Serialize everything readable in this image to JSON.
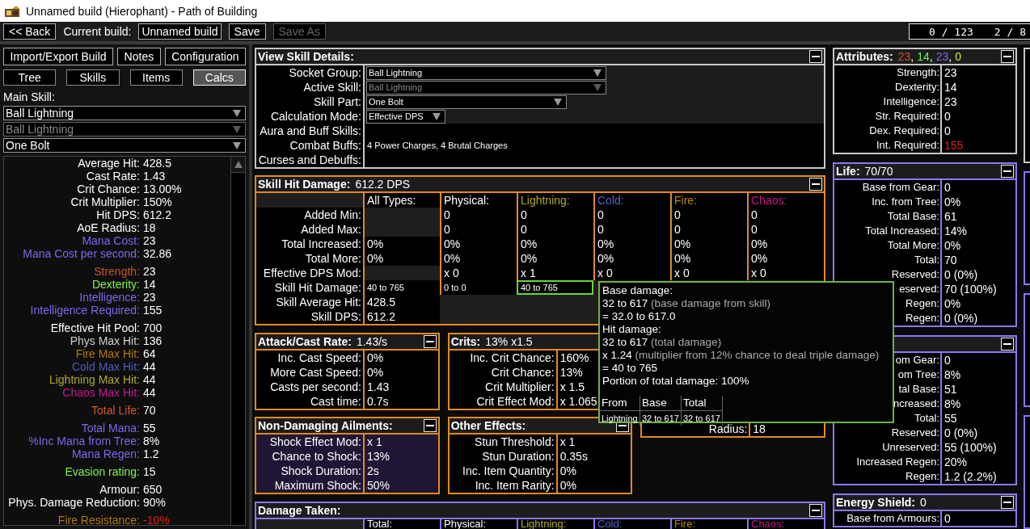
{
  "window": {
    "title": "Unnamed build (Hierophant) - Path of Building"
  },
  "toolbar": {
    "back": "<< Back",
    "current_build_label": "Current build:",
    "build_name": "Unnamed build",
    "buttons": [
      {
        "label": "Save",
        "disabled": false
      },
      {
        "label": "Save As",
        "disabled": true
      }
    ],
    "points": [
      "0 / 123",
      "2 / 8"
    ]
  },
  "left": {
    "buttons": [
      "Import/Export Build",
      "Notes",
      "Configuration"
    ],
    "tabs": [
      {
        "label": "Tree",
        "selected": false
      },
      {
        "label": "Skills",
        "selected": false
      },
      {
        "label": "Items",
        "selected": false
      },
      {
        "label": "Calcs",
        "selected": true
      }
    ],
    "main_skill_label": "Main Skill:",
    "dropdowns": [
      {
        "value": "Ball Lightning",
        "disabled": false
      },
      {
        "value": "Ball Lightning",
        "disabled": true
      },
      {
        "value": "One Bolt",
        "disabled": false
      }
    ],
    "stats": [
      [
        {
          "label": "Average Hit:",
          "value": "428.5",
          "color": "#ffffff"
        },
        {
          "label": "Cast Rate:",
          "value": "1.43",
          "color": "#ffffff"
        },
        {
          "label": "Crit Chance:",
          "value": "13.00%",
          "color": "#ffffff"
        },
        {
          "label": "Crit Multiplier:",
          "value": "150%",
          "color": "#ffffff"
        },
        {
          "label": "Hit DPS:",
          "value": "612.2",
          "color": "#ffffff"
        },
        {
          "label": "AoE Radius:",
          "value": "18",
          "color": "#ffffff"
        },
        {
          "label": "Mana Cost:",
          "value": "23",
          "color": "#7b68ee"
        },
        {
          "label": "Mana Cost per second:",
          "value": "32.86",
          "color": "#7b68ee"
        }
      ],
      [
        {
          "label": "Strength:",
          "value": "23",
          "color": "#c8552d"
        },
        {
          "label": "Dexterity:",
          "value": "14",
          "color": "#7cf34a"
        },
        {
          "label": "Intelligence:",
          "value": "23",
          "color": "#7b68ee"
        },
        {
          "label": "Intelligence Required:",
          "value": "155",
          "color": "#7b68ee"
        }
      ],
      [
        {
          "label": "Effective Hit Pool:",
          "value": "700",
          "color": "#ffffff"
        },
        {
          "label": "Phys Max Hit:",
          "value": "136",
          "color": "#d0d0d0"
        },
        {
          "label": "Fire Max Hit:",
          "value": "64",
          "color": "#b07a10"
        },
        {
          "label": "Cold Max Hit:",
          "value": "44",
          "color": "#4a5bbd"
        },
        {
          "label": "Lightning Max Hit:",
          "value": "44",
          "color": "#adaa2a"
        },
        {
          "label": "Chaos Max Hit:",
          "value": "44",
          "color": "#c41a8c"
        }
      ],
      [
        {
          "label": "Total Life:",
          "value": "70",
          "color": "#d0582e"
        }
      ],
      [
        {
          "label": "Total Mana:",
          "value": "55",
          "color": "#7b68ee"
        },
        {
          "label": "%Inc Mana from Tree:",
          "value": "8%",
          "color": "#7b68ee"
        },
        {
          "label": "Mana Regen:",
          "value": "1.2",
          "color": "#7b68ee"
        }
      ],
      [
        {
          "label": "Evasion rating:",
          "value": "15",
          "color": "#7cf34a"
        }
      ],
      [
        {
          "label": "Armour:",
          "value": "650",
          "color": "#ffffff"
        },
        {
          "label": "Phys. Damage Reduction:",
          "value": "90%",
          "color": "#ffffff"
        }
      ],
      [
        {
          "label": "Fire Resistance:",
          "value": {
            "text": "-10%",
            "color": "#e02020"
          },
          "color": "#b07a10"
        }
      ]
    ]
  },
  "skill_details": {
    "title": "View Skill Details:",
    "color": "#c8c8c8",
    "rows": [
      {
        "label": "Socket Group:",
        "kind": "dropdown",
        "value": "Ball Lightning",
        "disabled": false
      },
      {
        "label": "Active Skill:",
        "kind": "dropdown",
        "value": "Ball Lightning",
        "disabled": true
      },
      {
        "label": "Skill Part:",
        "kind": "dropdown",
        "value": "One Bolt",
        "disabled": false
      },
      {
        "label": "Calculation Mode:",
        "kind": "dropdown",
        "value": "Effective DPS",
        "disabled": false
      },
      {
        "label": "Aura and Buff Skills:",
        "kind": "text"
      },
      {
        "label": "Combat Buffs:",
        "kind": "text",
        "value": "4 Power Charges, 4 Brutal Charges"
      },
      {
        "label": "Curses and Debuffs:",
        "kind": "text"
      }
    ]
  },
  "hit_damage": {
    "title": "Skill Hit Damage:",
    "summary": "612.2 DPS",
    "color": "#e08a1e",
    "columns": [
      {
        "label": "All Types:"
      },
      {
        "label": "Physical:"
      },
      {
        "label": "Lightning:",
        "color": "#adaa2a"
      },
      {
        "label": "Cold:",
        "color": "#5a64c8"
      },
      {
        "label": "Fire:",
        "color": "#b8860b"
      },
      {
        "label": "Chaos:",
        "color": "#c41a8c"
      }
    ],
    "rows": [
      {
        "label": "Added Min:",
        "cells": [
          null,
          "0",
          "0",
          "0",
          "0",
          "0"
        ]
      },
      {
        "label": "Added Max:",
        "cells": [
          null,
          "0",
          "0",
          "0",
          "0",
          "0"
        ]
      },
      {
        "label": "Total Increased:",
        "cells": [
          "0%",
          "0%",
          "0%",
          "0%",
          "0%",
          "0%"
        ]
      },
      {
        "label": "Total More:",
        "cells": [
          "0%",
          "0%",
          "0%",
          "0%",
          "0%",
          "0%"
        ]
      },
      {
        "label": "Effective DPS Mod:",
        "cells": [
          null,
          "x 0",
          "x 1",
          "x 0",
          "x 0",
          "x 0"
        ]
      },
      {
        "label": "Skill Hit Damage:",
        "cells": [
          {
            "text": "40 to 765",
            "selected": false
          },
          {
            "text": "0 to 0",
            "selected": false
          },
          {
            "text": "40 to 765",
            "selected": true
          }
        ]
      },
      {
        "label": "Skill Average Hit:",
        "cells": [
          "428.5"
        ]
      },
      {
        "label": "Skill DPS:",
        "cells": [
          "612.2"
        ]
      }
    ]
  },
  "mid_panels": [
    {
      "title": "Attack/Cast Rate:",
      "summary": "1.43/s",
      "color": "#e08a1e",
      "kind": "stats",
      "rows": [
        {
          "label": "Inc. Cast Speed:",
          "value": "0%"
        },
        {
          "label": "More Cast Speed:",
          "value": "0%"
        },
        {
          "label": "Casts per second:",
          "value": "1.43"
        },
        {
          "label": "Cast time:",
          "value": "0.7s"
        }
      ]
    },
    {
      "title": "Crits:",
      "summary": "13% x1.5",
      "color": "#e08a1e",
      "kind": "stats",
      "rows": [
        {
          "label": "Inc. Crit Chance:",
          "value": "160%"
        },
        {
          "label": "Crit Chance:",
          "value": "13%"
        },
        {
          "label": "Crit Multiplier:",
          "value": "x 1.5"
        },
        {
          "label": "Crit Effect Mod:",
          "value": "x 1.065"
        }
      ]
    },
    {
      "title": "Non-Damaging Ailments:",
      "color": "#e08a1e",
      "kind": "ailment",
      "rows": [
        {
          "label": "Shock Effect Mod:",
          "value": "x 1"
        },
        {
          "label": "Chance to Shock:",
          "value": "13%"
        },
        {
          "label": "Shock Duration:",
          "value": "2s"
        },
        {
          "label": "Maximum Shock:",
          "value": "50%"
        }
      ]
    },
    {
      "title": "Other Effects:",
      "color": "#e08a1e",
      "kind": "stats",
      "rows": [
        {
          "label": "Stun Threshold:",
          "value": "x 1"
        },
        {
          "label": "Stun Duration:",
          "value": "0.35s"
        },
        {
          "label": "Inc. Item Quantity:",
          "value": "0%"
        },
        {
          "label": "Inc. Item Rarity:",
          "value": "0%"
        }
      ]
    },
    {
      "color": "#e08a1e",
      "kind": "stats",
      "rows": [
        {
          "label": "Radius:",
          "value": "18"
        }
      ]
    }
  ],
  "damage_taken": {
    "title": "Damage Taken:",
    "color": "#8b78f0",
    "columns": [
      {
        "label": "Total:"
      },
      {
        "label": "Physical:"
      },
      {
        "label": "Lightning:",
        "color": "#adaa2a"
      },
      {
        "label": "Cold:",
        "color": "#5a64c8"
      },
      {
        "label": "Fire:",
        "color": "#b8860b"
      },
      {
        "label": "Chaos:",
        "color": "#c41a8c"
      }
    ]
  },
  "right_panels": [
    {
      "title": "Attributes:",
      "color": "#c8c8c8",
      "summary_parts": [
        {
          "text": "23",
          "kind": "strength",
          "separator": ","
        },
        {
          "text": "14",
          "kind": "dexterity",
          "separator": ","
        },
        {
          "text": "23",
          "kind": "intelligence",
          "separator": ","
        },
        {
          "text": "0",
          "kind": "other"
        }
      ],
      "rows": [
        {
          "label": "Strength:",
          "value": "23"
        },
        {
          "label": "Dexterity:",
          "value": "14"
        },
        {
          "label": "Intelligence:",
          "value": "23"
        },
        {
          "label": "Str. Required:",
          "value": "0"
        },
        {
          "label": "Dex. Required:",
          "value": "0"
        },
        {
          "label": "Int. Required:",
          "value": {
            "text": "155",
            "color": "#e02020"
          }
        }
      ]
    },
    {
      "title": "Life:",
      "summary": "70/70",
      "color": "#8b78f0",
      "rows": [
        {
          "label": "Base from Gear:",
          "value": "0"
        },
        {
          "label": "Inc. from Tree:",
          "value": "0%"
        },
        {
          "label": "Total Base:",
          "value": "61"
        },
        {
          "label": "Total Increased:",
          "value": "14%"
        },
        {
          "label": "Total More:",
          "value": "0%"
        },
        {
          "label": "Total:",
          "value": "70"
        },
        {
          "label": "Reserved:",
          "value": "0 (0%)"
        },
        {
          "label": "eserved:",
          "value": "70 (100%)"
        },
        {
          "label": "Regen:",
          "value": "0%"
        },
        {
          "label": "Regen:",
          "value": "0 (0%)"
        }
      ]
    },
    {
      "color": "#8b78f0",
      "rows": [
        {
          "label": "om Gear:",
          "value": "0"
        },
        {
          "label": "om Tree:",
          "value": "8%"
        },
        {
          "label": "tal Base:",
          "value": "51"
        },
        {
          "label": "ncreased:",
          "value": "8%"
        },
        {
          "label": "Total:",
          "value": "55"
        },
        {
          "label": "Reserved:",
          "value": "0 (0%)"
        },
        {
          "label": "Unreserved:",
          "value": "55 (100%)"
        },
        {
          "label": "Increased Regen:",
          "value": "20%"
        },
        {
          "label": "Regen:",
          "value": "1.2 (2.2%)"
        }
      ]
    },
    {
      "title": "Energy Shield:",
      "summary": "0",
      "color": "#8b78f0",
      "rows": [
        {
          "label": "Base from Armours:",
          "value": "0"
        }
      ]
    }
  ],
  "tooltip": {
    "lines": [
      {
        "text": "Base damage:"
      },
      {
        "text": "32 to 617",
        "note": "(base damage from skill)"
      },
      {
        "text": "= 32.0 to 617.0"
      },
      {
        "text": "Hit damage:"
      },
      {
        "text": "32 to 617",
        "note": "(total damage)"
      },
      {
        "text": "x 1.24",
        "note": "(multiplier from 12% chance to deal triple damage)"
      },
      {
        "text": "= 40 to 765"
      },
      {
        "text": "Portion of total damage: 100%"
      }
    ],
    "table": {
      "columns": [
        "From",
        "Base",
        "Total"
      ],
      "rows": [
        [
          "Lightning",
          "32 to 617",
          "32 to 617"
        ]
      ]
    }
  }
}
